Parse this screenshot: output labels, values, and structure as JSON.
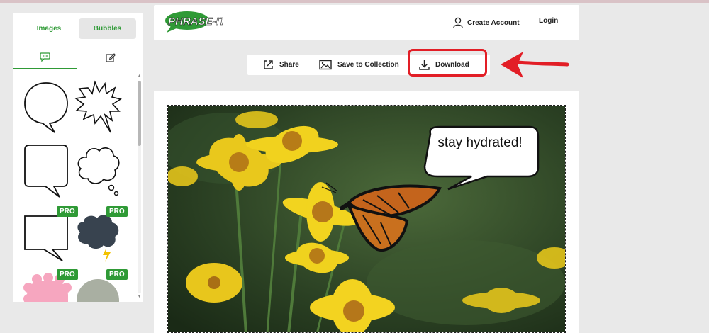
{
  "sidebar": {
    "tab_images": "Images",
    "tab_bubbles": "Bubbles",
    "pro_badge": "PRO"
  },
  "header": {
    "logo_text": "PHRASE-IT",
    "create_account": "Create Account",
    "login": "Login"
  },
  "toolbar": {
    "share": "Share",
    "save_to_collection": "Save to Collection",
    "download": "Download"
  },
  "canvas": {
    "bubble_text": "stay hydrated!"
  },
  "colors": {
    "brand_green": "#2f9a36",
    "highlight_red": "#e21e26",
    "page_bg": "#e9e9e9"
  }
}
